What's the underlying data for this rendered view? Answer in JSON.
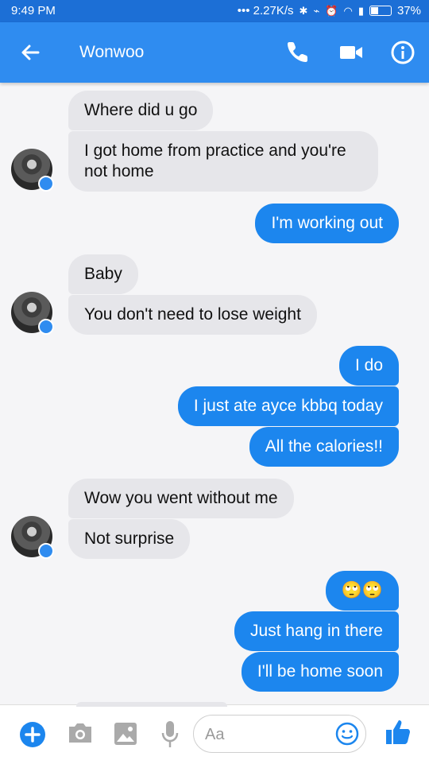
{
  "status_bar": {
    "time": "9:49 PM",
    "net_speed": "••• 2.27K/s",
    "battery": "37%"
  },
  "header": {
    "title": "Wonwoo"
  },
  "messages": [
    {
      "dir": "in",
      "text": "Where did u go"
    },
    {
      "dir": "in",
      "text": "I got home from practice and you're not home"
    },
    {
      "dir": "out",
      "text": "I'm working out"
    },
    {
      "dir": "in",
      "text": "Baby"
    },
    {
      "dir": "in",
      "text": "You don't need to lose weight"
    },
    {
      "dir": "out",
      "text": "I do"
    },
    {
      "dir": "out",
      "text": "I just ate ayce kbbq today"
    },
    {
      "dir": "out",
      "text": "All the calories!!"
    },
    {
      "dir": "in",
      "text": "Wow you went without me"
    },
    {
      "dir": "in",
      "text": "Not surprise"
    },
    {
      "dir": "out",
      "text": "🙄🙄"
    },
    {
      "dir": "out",
      "text": "Just hang in there"
    },
    {
      "dir": "out",
      "text": "I'll be home soon"
    }
  ],
  "composer": {
    "placeholder": "Aa"
  },
  "colors": {
    "header": "#2f8cf0",
    "status_bar": "#1c6fd6",
    "outgoing": "#1c86ee",
    "incoming": "#e6e6ea"
  }
}
